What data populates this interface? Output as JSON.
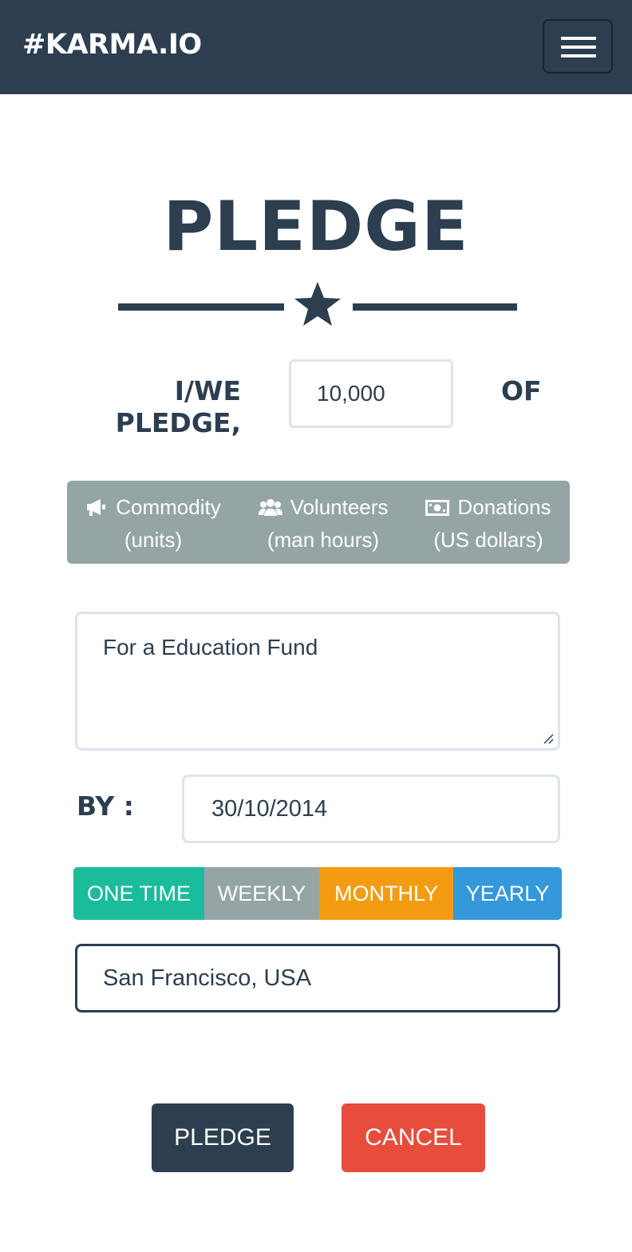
{
  "navbar": {
    "brand": "#KARMA.IO",
    "menu_icon": "hamburger-menu-icon"
  },
  "main": {
    "title": "PLEDGE",
    "divider_icon": "star-icon",
    "pledge_label_line1": "I/WE",
    "pledge_label_line2": "PLEDGE,",
    "amount_value": "10,000",
    "of_label": "OF",
    "pledge_types": [
      {
        "icon": "megaphone-icon",
        "label": "Commodity",
        "sublabel": "(units)"
      },
      {
        "icon": "users-icon",
        "label": "Volunteers",
        "sublabel": "(man hours)"
      },
      {
        "icon": "money-icon",
        "label": "Donations",
        "sublabel": "(US dollars)"
      }
    ],
    "description_value": "For a Education Fund",
    "by_label": "BY :",
    "date_value": "30/10/2014",
    "frequencies": [
      {
        "label": "ONE TIME",
        "color": "#1abc9c"
      },
      {
        "label": "WEEKLY",
        "color": "#95a5a6"
      },
      {
        "label": "MONTHLY",
        "color": "#f39c12"
      },
      {
        "label": "YEARLY",
        "color": "#3498db"
      }
    ],
    "location_value": "San Francisco, USA",
    "pledge_button": "PLEDGE",
    "cancel_button": "CANCEL"
  },
  "colors": {
    "navbar_bg": "#2c3e50",
    "primary": "#2c3e50",
    "group_bg": "#95a5a6",
    "cancel": "#e74c3c"
  }
}
